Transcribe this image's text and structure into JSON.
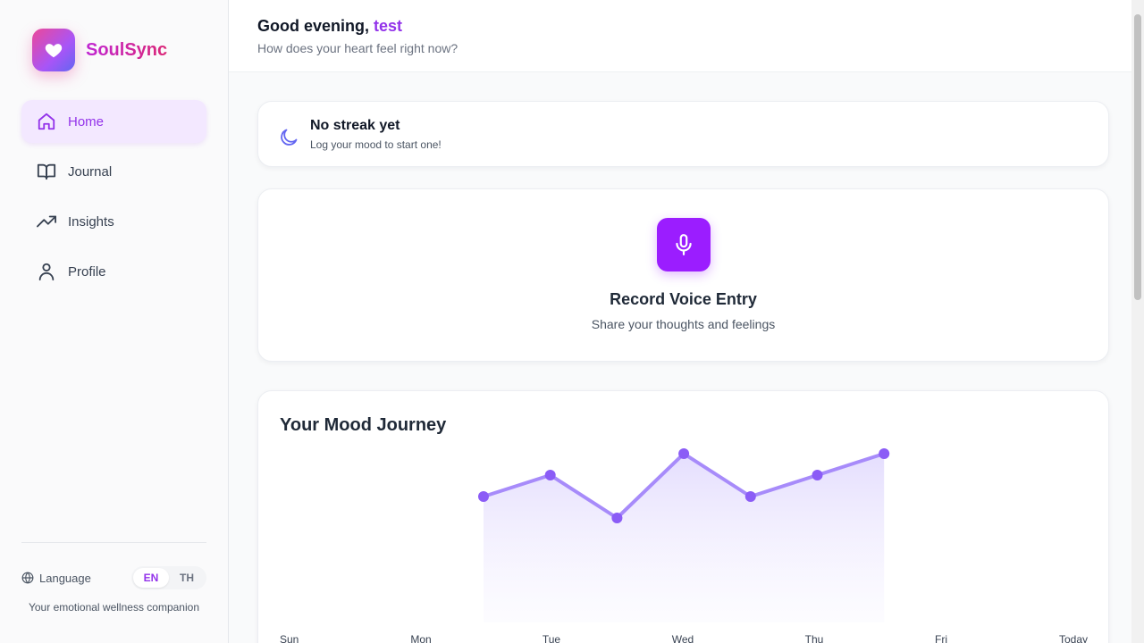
{
  "brand": {
    "name": "SoulSync"
  },
  "nav": {
    "items": [
      {
        "label": "Home",
        "icon": "home-icon",
        "active": true
      },
      {
        "label": "Journal",
        "icon": "book-open-icon",
        "active": false
      },
      {
        "label": "Insights",
        "icon": "trending-up-icon",
        "active": false
      },
      {
        "label": "Profile",
        "icon": "user-icon",
        "active": false
      }
    ]
  },
  "footer": {
    "language_label": "Language",
    "languages": [
      "EN",
      "TH"
    ],
    "selected_language": "EN",
    "tagline": "Your emotional wellness companion"
  },
  "header": {
    "greeting": "Good evening,",
    "user_name": "test",
    "subtitle": "How does your heart feel right now?"
  },
  "streak": {
    "title": "No streak yet",
    "subtitle": "Log your mood to start one!"
  },
  "record": {
    "title": "Record Voice Entry",
    "subtitle": "Share your thoughts and feelings"
  },
  "mood": {
    "title": "Your Mood Journey"
  },
  "chart_data": {
    "type": "area",
    "title": "Your Mood Journey",
    "categories": [
      "Sun",
      "Mon",
      "Tue",
      "Wed",
      "Thu",
      "Fri",
      "Today"
    ],
    "series": [
      {
        "values": [
          3,
          4,
          2,
          5,
          3,
          4,
          5
        ]
      }
    ],
    "ylim": [
      0,
      5
    ],
    "grid": false
  },
  "colors": {
    "accent": "#9333ea",
    "mic_button": "#9b1dff",
    "line": "#a78bfa",
    "point": "#8b5cf6"
  }
}
